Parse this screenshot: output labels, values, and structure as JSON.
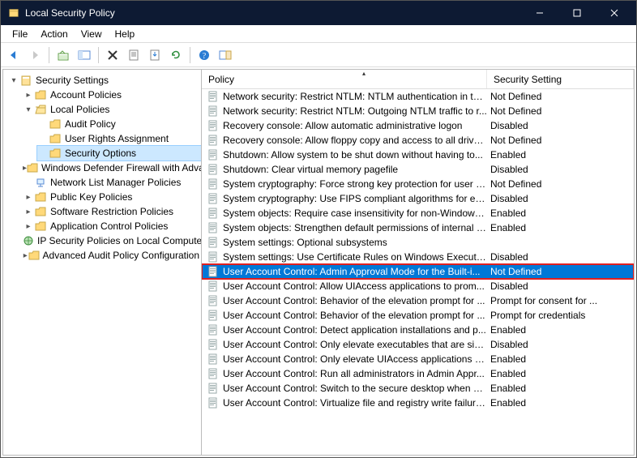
{
  "window": {
    "title": "Local Security Policy"
  },
  "menu": {
    "file": "File",
    "action": "Action",
    "view": "View",
    "help": "Help"
  },
  "tree": {
    "root": "Security Settings",
    "account": "Account Policies",
    "local": "Local Policies",
    "audit": "Audit Policy",
    "ura": "User Rights Assignment",
    "secopt": "Security Options",
    "firewall": "Windows Defender Firewall with Advanced Security",
    "nlm": "Network List Manager Policies",
    "pk": "Public Key Policies",
    "srp": "Software Restriction Policies",
    "acp": "Application Control Policies",
    "ipsec": "IP Security Policies on Local Computer",
    "aapc": "Advanced Audit Policy Configuration"
  },
  "columns": {
    "policy": "Policy",
    "setting": "Security Setting"
  },
  "policies": [
    {
      "name": "Network security: Restrict NTLM: NTLM authentication in thi...",
      "setting": "Not Defined"
    },
    {
      "name": "Network security: Restrict NTLM: Outgoing NTLM traffic to r...",
      "setting": "Not Defined"
    },
    {
      "name": "Recovery console: Allow automatic administrative logon",
      "setting": "Disabled"
    },
    {
      "name": "Recovery console: Allow floppy copy and access to all drives...",
      "setting": "Not Defined"
    },
    {
      "name": "Shutdown: Allow system to be shut down without having to...",
      "setting": "Enabled"
    },
    {
      "name": "Shutdown: Clear virtual memory pagefile",
      "setting": "Disabled"
    },
    {
      "name": "System cryptography: Force strong key protection for user k...",
      "setting": "Not Defined"
    },
    {
      "name": "System cryptography: Use FIPS compliant algorithms for en...",
      "setting": "Disabled"
    },
    {
      "name": "System objects: Require case insensitivity for non-Windows ...",
      "setting": "Enabled"
    },
    {
      "name": "System objects: Strengthen default permissions of internal s...",
      "setting": "Enabled"
    },
    {
      "name": "System settings: Optional subsystems",
      "setting": ""
    },
    {
      "name": "System settings: Use Certificate Rules on Windows Executab...",
      "setting": "Disabled"
    },
    {
      "name": "User Account Control: Admin Approval Mode for the Built-i...",
      "setting": "Not Defined",
      "selected": true
    },
    {
      "name": "User Account Control: Allow UIAccess applications to prom...",
      "setting": "Disabled"
    },
    {
      "name": "User Account Control: Behavior of the elevation prompt for ...",
      "setting": "Prompt for consent for ..."
    },
    {
      "name": "User Account Control: Behavior of the elevation prompt for ...",
      "setting": "Prompt for credentials"
    },
    {
      "name": "User Account Control: Detect application installations and p...",
      "setting": "Enabled"
    },
    {
      "name": "User Account Control: Only elevate executables that are sig...",
      "setting": "Disabled"
    },
    {
      "name": "User Account Control: Only elevate UIAccess applications th...",
      "setting": "Enabled"
    },
    {
      "name": "User Account Control: Run all administrators in Admin Appr...",
      "setting": "Enabled"
    },
    {
      "name": "User Account Control: Switch to the secure desktop when pr...",
      "setting": "Enabled"
    },
    {
      "name": "User Account Control: Virtualize file and registry write failure...",
      "setting": "Enabled"
    }
  ]
}
